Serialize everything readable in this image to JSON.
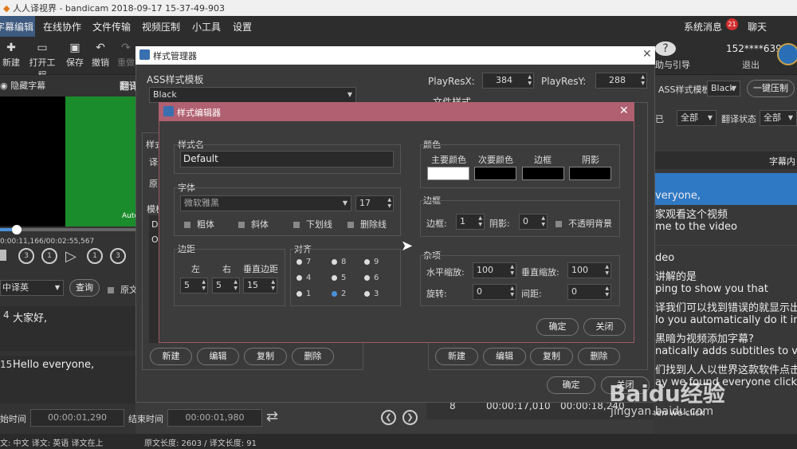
{
  "window": {
    "title": "人人译视界 - bandicam 2018-09-17 15-37-49-903"
  },
  "menu": [
    "字幕编辑",
    "在线协作",
    "文件传输",
    "视频压制",
    "小工具",
    "设置"
  ],
  "header_right": {
    "notifications_label": "系统消息",
    "notifications_count": "21",
    "chat_label": "聊天",
    "user": "152****6399",
    "logout": "退出"
  },
  "toolbar": {
    "new": "新建",
    "open": "打开工程",
    "save": "保存",
    "undo": "撤销",
    "redo": "重做",
    "help": "助与引导",
    "ass_label": "ASS样式模板",
    "ass_value": "Black",
    "compress": "一键压制"
  },
  "left_panel": {
    "hide_sub": "隐藏字幕",
    "translate": "翻译",
    "auto": "Auto",
    "time": "0:00:11,166/00:02:55,567",
    "lang": "中译英",
    "query": "查询",
    "orig_label": "原文",
    "rows": [
      {
        "num": "4",
        "text": "大家好,"
      },
      {
        "num": "15",
        "text": "Hello everyone,"
      }
    ],
    "start_label": "始时间",
    "start_value": "00:00:01,290",
    "end_label": "结束时间",
    "end_value": "00:00:01,980"
  },
  "status_bar": {
    "left": "文: 中文 译文: 英语 译文在上",
    "mid": "原文长度: 2603 / 译文长度: 91"
  },
  "right_panel": {
    "filter1": "全部",
    "trans_status": "翻译状态",
    "filter2": "全部",
    "partial1": "已",
    "header": "字幕内",
    "lines": [
      "veryone,",
      "家观看这个视频",
      "me to the video",
      "deo",
      "讲解的是",
      "ping to show you that",
      "译我们可以找到错误的就显示出",
      "lo you automatically do it in a",
      "黑暗为视频添加字幕?",
      "natically adds subtitles to vide",
      "们找到人人以世界这款软件点击",
      "ay we found everyone clickin",
      "And then we click"
    ]
  },
  "bottom_table": {
    "num": "8",
    "start": "00:00:17,010",
    "end": "00:00:18,240"
  },
  "style_manager": {
    "title": "样式管理器",
    "ass_template_label": "ASS样式模板",
    "ass_template_value": "Black",
    "playresx_label": "PlayResX:",
    "playresx_value": "384",
    "playresy_label": "PlayResY:",
    "playresy_value": "288",
    "file_style_label": "文件样式",
    "left_groups": [
      "样式",
      "译",
      "原",
      "模板"
    ],
    "list_items": [
      "D",
      "O"
    ],
    "buttons_left": [
      "新建",
      "编辑",
      "复制",
      "删除"
    ],
    "buttons_right": [
      "新建",
      "编辑",
      "复制",
      "删除"
    ],
    "ok": "确定",
    "close": "关闭"
  },
  "style_editor": {
    "title": "样式编辑器",
    "style_name_label": "样式名",
    "style_name_value": "Default",
    "font_label": "字体",
    "font_value": "微软雅黑",
    "font_size": "17",
    "bold": "粗体",
    "italic": "斜体",
    "underline": "下划线",
    "strike": "删除线",
    "margin_label": "边距",
    "margin_left": "左",
    "margin_right": "右",
    "margin_vert": "垂直边距",
    "margin_left_value": "5",
    "margin_right_value": "5",
    "margin_vert_value": "15",
    "align_label": "对齐",
    "align_values": [
      "7",
      "8",
      "9",
      "4",
      "5",
      "6",
      "1",
      "2",
      "3"
    ],
    "align_selected": "2",
    "color_label": "颜色",
    "color_primary": "主要颜色",
    "color_secondary": "次要颜色",
    "color_border": "边框",
    "color_shadow": "阴影",
    "color_primary_hex": "#ffffff",
    "color_secondary_hex": "#000000",
    "color_border_hex": "#000000",
    "color_shadow_hex": "#000000",
    "border_label": "边框",
    "border_size_label": "边框:",
    "border_size_value": "1",
    "shadow_label": "阴影:",
    "shadow_value": "0",
    "opaque_bg": "不透明背景",
    "misc_label": "杂项",
    "hscale_label": "水平缩放:",
    "hscale_value": "100",
    "vscale_label": "垂直缩放:",
    "vscale_value": "100",
    "rotate_label": "旋转:",
    "rotate_value": "0",
    "spacing_label": "间距:",
    "spacing_value": "0",
    "ok": "确定",
    "close": "关闭"
  },
  "watermark": {
    "text": "Baidu经验",
    "url": "jingyan.baidu.com"
  }
}
